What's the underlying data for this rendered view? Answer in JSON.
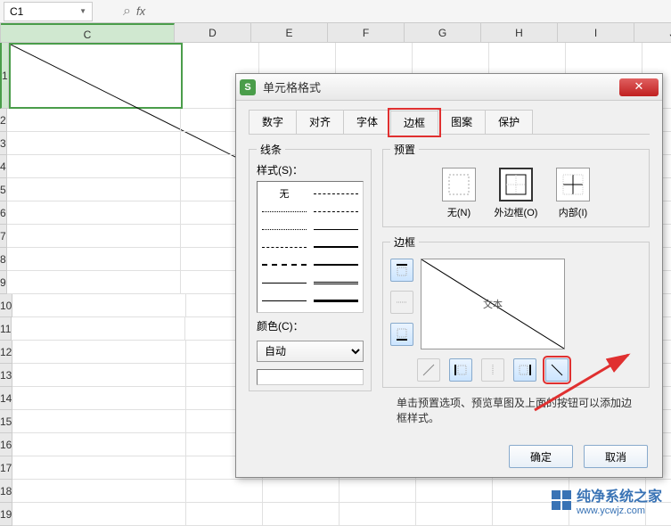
{
  "formulaBar": {
    "cellRef": "C1"
  },
  "columns": [
    "C",
    "D",
    "E",
    "F",
    "G",
    "H",
    "I",
    "J"
  ],
  "rows": [
    "1",
    "2",
    "3",
    "4",
    "5",
    "6",
    "7",
    "8",
    "9",
    "10",
    "11",
    "12",
    "13",
    "14",
    "15",
    "16",
    "17",
    "18",
    "19"
  ],
  "dialog": {
    "title": "单元格格式",
    "tabs": [
      "数字",
      "对齐",
      "字体",
      "边框",
      "图案",
      "保护"
    ],
    "activeTab": "边框",
    "line": {
      "groupLabel": "线条",
      "styleLabel": "样式(S)：",
      "noneLabel": "无",
      "colorLabel": "颜色(C)：",
      "colorValue": "自动"
    },
    "preset": {
      "groupLabel": "预置",
      "none": "无(N)",
      "outer": "外边框(O)",
      "inner": "内部(I)"
    },
    "border": {
      "groupLabel": "边框",
      "previewText": "文本"
    },
    "hint": "单击预置选项、预览草图及上面的按钮可以添加边框样式。",
    "ok": "确定",
    "cancel": "取消"
  },
  "watermark": {
    "name": "纯净系统之家",
    "url": "www.ycwjz.com"
  }
}
